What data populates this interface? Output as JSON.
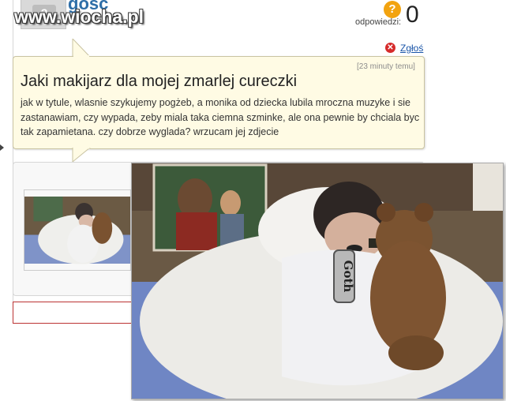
{
  "header": {
    "watermark": "www.wiocha.pl",
    "username": "gosc",
    "answers_label": "odpowiedzi:",
    "answers_count": "0",
    "report_label": "Zgłoś"
  },
  "question": {
    "time": "[23 minuty temu]",
    "title": "Jaki makijarz dla mojej zmarlej cureczki",
    "body": "jak w tytule, wlasnie szykujemy pogżeb, a monika od dziecka lubila mroczna muzyke i sie zastanawiam, czy wypada, zeby miala taka ciemna szminke, ale ona pewnie by chciala byc tak zapamietana. czy dobrze wyglada? wrzucam jej zdjecie"
  },
  "photo": {
    "tag_text": "Goth"
  },
  "colors": {
    "link": "#1a55a8",
    "username": "#2f6fa8",
    "bubble_bg": "#fffbe4",
    "help_icon": "#f2a310",
    "report_icon": "#d62b2b"
  },
  "icons": [
    "avatar-placeholder-icon",
    "help-icon",
    "report-icon",
    "left-arrow-icon"
  ]
}
